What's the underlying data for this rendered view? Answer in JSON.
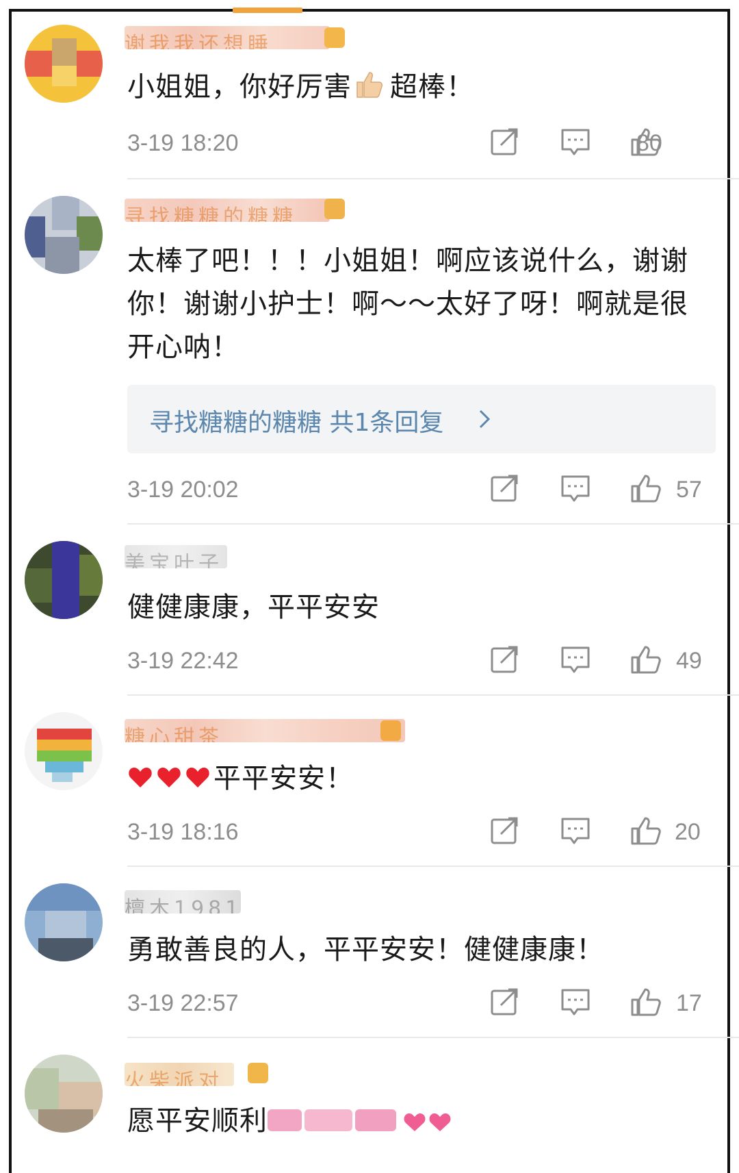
{
  "comments": [
    {
      "username_hint": "谢我我还想睡",
      "text_parts": [
        "小姐姐，你好厉害",
        "超棒！"
      ],
      "time": "3-19 18:20",
      "likes": "80"
    },
    {
      "username_hint": "寻找糖糖的糖糖",
      "text": "太棒了吧！！！小姐姐！啊应该说什么，谢谢你！谢谢小护士！啊～～太好了呀！啊就是很开心呐！",
      "reply_link": "寻找糖糖的糖糖  共1条回复",
      "time": "3-19 20:02",
      "likes": "57"
    },
    {
      "username_hint": "美宝叶子",
      "text": "健健康康，平平安安",
      "time": "3-19 22:42",
      "likes": "49"
    },
    {
      "username_hint": "糖心甜茶",
      "text": "平平安安！",
      "time": "3-19 18:16",
      "likes": "20"
    },
    {
      "username_hint": "檀木1981",
      "text": "勇敢善良的人，平平安安！健健康康！",
      "time": "3-19 22:57",
      "likes": "17"
    },
    {
      "username_hint": "火柴派对",
      "text": "愿平安顺利"
    }
  ],
  "icons": {
    "share": "share-icon",
    "comment": "comment-icon",
    "like": "thumbs-up-icon",
    "heart": "heart-icon",
    "chevron": "chevron-right-icon"
  },
  "colors": {
    "reply_link": "#5b86ad",
    "meta": "#8d8d8d",
    "heart": "#e8212d"
  }
}
